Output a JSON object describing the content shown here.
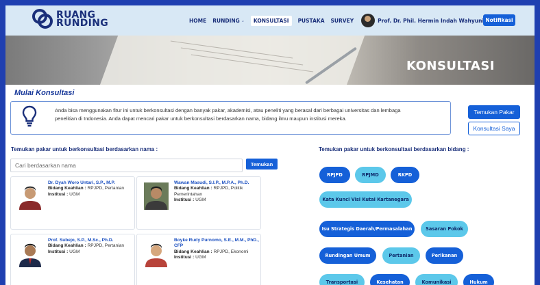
{
  "header": {
    "logo_line1": "RUANG",
    "logo_line2": "RUNDING",
    "nav": [
      {
        "label": "HOME",
        "dropdown": false,
        "active": false
      },
      {
        "label": "RUNDING",
        "dropdown": true,
        "active": false
      },
      {
        "label": "KONSULTASI",
        "dropdown": false,
        "active": true
      },
      {
        "label": "PUSTAKA",
        "dropdown": false,
        "active": false
      },
      {
        "label": "SURVEY",
        "dropdown": false,
        "active": false
      }
    ],
    "profile_name": "Prof. Dr. Phil. Hermin Indah Wahyuni, M.Si.",
    "notif_label": "Notifikasi"
  },
  "banner": {
    "title": "KONSULTASI"
  },
  "intro": {
    "title": "Mulai Konsultasi",
    "text": "Anda bisa menggunakan fitur ini untuk berkonsultasi dengan banyak pakar, akademisi, atau peneliti yang berasal dari berbagai universitas dan lembaga penelitian di Indonesia. Anda dapat mencari pakar untuk berkonsultasi berdasarkan nama, bidang ilmu maupun institusi mereka.",
    "btn_find": "Temukan Pakar",
    "btn_mine": "Konsultasi Saya"
  },
  "search": {
    "title": "Temukan pakar untuk berkonsultasi berdasarkan nama :",
    "placeholder": "Cari berdasarkan nama",
    "button": "Temukan"
  },
  "experts": [
    {
      "name": "Dr. Dyah Woro Untari, S.P., M.P.",
      "bidang_label": "Bidang Keahlian :",
      "bidang": "RPJPD, Pertanian",
      "inst_label": "Institusi :",
      "institusi": "UGM"
    },
    {
      "name": "Wawan Masudi, S.I.P., M.P.A., Ph.D.",
      "bidang_label": "Bidang Keahlian :",
      "bidang": "RPJPD, Politik Pemerintahan",
      "inst_label": "Institusi :",
      "institusi": "UGM"
    },
    {
      "name": "Prof. Subejo, S.P., M.Sc., Ph.D.",
      "bidang_label": "Bidang Keahlian :",
      "bidang": "RPJPD, Pertanian",
      "inst_label": "Institusi :",
      "institusi": "UGM"
    },
    {
      "name": "Boyke Rudy Purnomo, S.E., M.M., PhD., CFP",
      "bidang_label": "Bidang Keahlian :",
      "bidang": "RPJPD, Ekonomi",
      "inst_label": "Institusi :",
      "institusi": "UGM"
    }
  ],
  "bidang": {
    "title": "Temukan pakar untuk berkonsultasi berdasarkan bidang :",
    "chips": [
      {
        "label": "RPJPD",
        "style": "dark"
      },
      {
        "label": "RPJMD",
        "style": "light"
      },
      {
        "label": "RKPD",
        "style": "dark"
      },
      {
        "label": "Kata Kunci Visi Kutai Kartanegara",
        "style": "light"
      },
      {
        "label": "Isu Strategis Daerah/Permasalahan",
        "style": "dark"
      },
      {
        "label": "Sasaran Pokok",
        "style": "light"
      },
      {
        "label": "Rundingan Umum",
        "style": "dark"
      },
      {
        "label": "Pertanian",
        "style": "light"
      },
      {
        "label": "Perikanan",
        "style": "dark"
      },
      {
        "label": "Transportasi",
        "style": "light"
      },
      {
        "label": "Kesehatan",
        "style": "dark"
      },
      {
        "label": "Komunikasi",
        "style": "light"
      },
      {
        "label": "Hukum",
        "style": "dark"
      }
    ]
  },
  "colors": {
    "primary": "#1560d8",
    "chip_light": "#5cc8ea",
    "nav_text": "#1a2f7a",
    "frame": "#1f3fb0"
  }
}
